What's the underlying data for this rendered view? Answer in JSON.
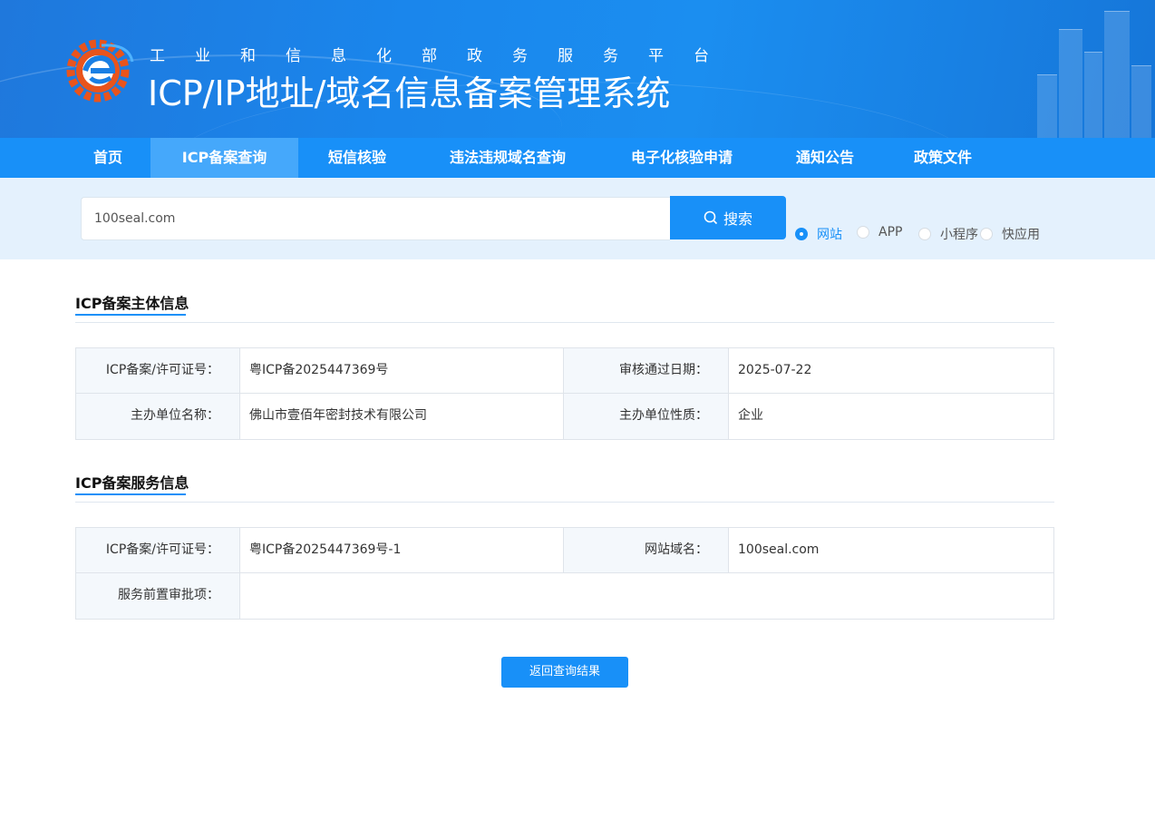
{
  "header": {
    "subtitle": "工业和信息化部政务服务平台",
    "title": "ICP/IP地址/域名信息备案管理系统"
  },
  "nav": {
    "items": [
      {
        "label": "首页",
        "active": false
      },
      {
        "label": "ICP备案查询",
        "active": true
      },
      {
        "label": "短信核验",
        "active": false
      },
      {
        "label": "违法违规域名查询",
        "active": false
      },
      {
        "label": "电子化核验申请",
        "active": false
      },
      {
        "label": "通知公告",
        "active": false
      },
      {
        "label": "政策文件",
        "active": false
      }
    ]
  },
  "search": {
    "value": "100seal.com",
    "button_label": "搜索",
    "options": [
      {
        "label": "网站",
        "checked": true
      },
      {
        "label": "APP",
        "checked": false
      },
      {
        "label": "小程序",
        "checked": false
      },
      {
        "label": "快应用",
        "checked": false
      }
    ]
  },
  "subject_section": {
    "title": "ICP备案主体信息",
    "rows": [
      {
        "label1": "ICP备案/许可证号：",
        "value1": "粤ICP备2025447369号",
        "label2": "审核通过日期：",
        "value2": "2025-07-22"
      },
      {
        "label1": "主办单位名称：",
        "value1": "佛山市壹佰年密封技术有限公司",
        "label2": "主办单位性质：",
        "value2": "企业"
      }
    ]
  },
  "service_section": {
    "title": "ICP备案服务信息",
    "rows": [
      {
        "label1": "ICP备案/许可证号：",
        "value1": "粤ICP备2025447369号-1",
        "label2": "网站域名：",
        "value2": "100seal.com"
      },
      {
        "label1": "服务前置审批项：",
        "value1": ""
      }
    ]
  },
  "back_button_label": "返回查询结果",
  "colors": {
    "primary": "#1890f8",
    "nav_active": "#45a8fb",
    "search_bg": "#e4f1fd"
  }
}
